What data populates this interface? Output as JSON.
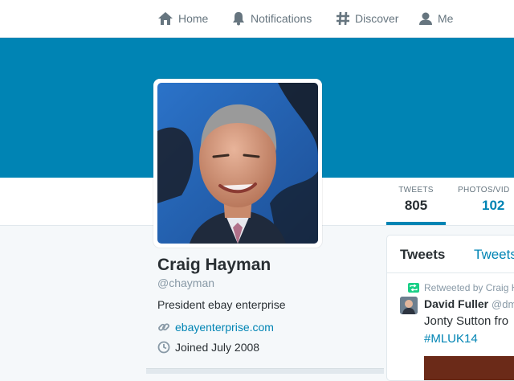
{
  "nav": {
    "home": "Home",
    "notifications": "Notifications",
    "discover": "Discover",
    "me": "Me"
  },
  "profile": {
    "name": "Craig Hayman",
    "screen_name": "@chayman",
    "bio": "President ebay enterprise",
    "url": "ebayenterprise.com",
    "joined": "Joined July 2008"
  },
  "stats": {
    "tweets_label": "TWEETS",
    "tweets_value": "805",
    "photos_label": "PHOTOS/VID",
    "photos_value": "102"
  },
  "timeline": {
    "tab_1": "Tweets",
    "tab_2": "Tweets",
    "retweeted_by": "Retweeted by Craig H",
    "author_name": "David Fuller",
    "author_handle": "@dm",
    "text": "Jonty Sutton fro",
    "hashtag": "#MLUK14"
  },
  "colors": {
    "banner": "#0084b4",
    "link": "#0084b4",
    "retweet": "#19cf86"
  }
}
